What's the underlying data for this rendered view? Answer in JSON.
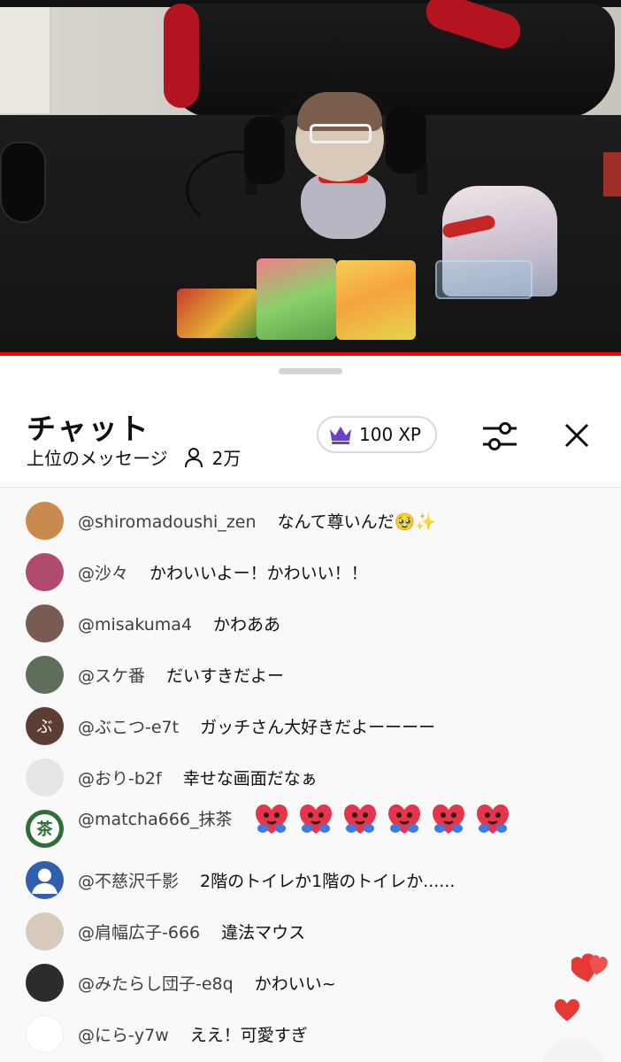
{
  "video": {
    "progress_pct": 100
  },
  "chat": {
    "title": "チャット",
    "mode_label": "上位のメッセージ",
    "viewer_count": "2万",
    "xp_amount": "100",
    "xp_unit": "XP",
    "icons": [
      "viewer-icon",
      "crown-icon",
      "filter-icon",
      "close-icon",
      "heart-reaction-icon"
    ],
    "messages": [
      {
        "author": "@shiromadoushi_zen",
        "text": "なんて尊いんだ🥹✨",
        "avatar_color": "#c98a4e"
      },
      {
        "author": "@沙々",
        "text": "かわいいよー！かわいい！！",
        "avatar_color": "#b04a6e"
      },
      {
        "author": "@misakuma4",
        "text": "かわああ",
        "avatar_color": "#7a5b53"
      },
      {
        "author": "@スケ番",
        "text": "だいすきだよー",
        "avatar_color": "#5f6e5a"
      },
      {
        "author": "@ぶこつ-e7t",
        "text": "ガッチさん大好きだよーーーー",
        "avatar_text": "ぶ",
        "avatar_color": "#5b3d33"
      },
      {
        "author": "@おり-b2f",
        "text": "幸せな画面だなぁ",
        "avatar_color": "#e6e6e6"
      },
      {
        "author": "@matcha666_抹茶",
        "text": "",
        "avatar_text": "茶",
        "avatar_color": "#2f6d36",
        "emoji_count": 6
      },
      {
        "author": "@不慈沢千影",
        "text": "2階のトイレか1階のトイレか......",
        "avatar_color": "#2f5fae"
      },
      {
        "author": "@肩幅広子-666",
        "text": "違法マウス",
        "avatar_color": "#d8c9bd"
      },
      {
        "author": "@みたらし団子-e8q",
        "text": "かわいい~",
        "avatar_color": "#2c2c2c"
      },
      {
        "author": "@にら-y7w",
        "text": "ええ！可愛すぎ",
        "avatar_color": "#ffffff"
      }
    ],
    "heart_color": "#e53935"
  }
}
